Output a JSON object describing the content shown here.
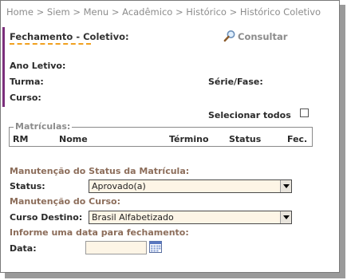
{
  "breadcrumb": "Home > Siem > Menu > Acadêmico > Histórico > Histórico Coletivo",
  "title": "Fechamento - Coletivo:",
  "consultar": "Consultar",
  "labels": {
    "ano_letivo": "Ano Letivo:",
    "turma": "Turma:",
    "serie_fase": "Série/Fase:",
    "curso": "Curso:",
    "selecionar_todos": "Selecionar todos"
  },
  "matriculas": {
    "legend": "Matrículas:",
    "columns": [
      "RM",
      "Nome",
      "Término",
      "Status",
      "Fec."
    ]
  },
  "status_section": {
    "heading": "Manutenção do Status da Matrícula:",
    "label": "Status:",
    "value": "Aprovado(a)"
  },
  "curso_section": {
    "heading": "Manutenção do Curso:",
    "label": "Curso Destino:",
    "value": "Brasil Alfabetizado"
  },
  "data_section": {
    "heading": "Informe uma data para fechamento:",
    "label": "Data:",
    "value": ""
  },
  "colors": {
    "accent_bar": "#7b2f7b",
    "underline": "#f0a020",
    "section_heading": "#8c6d5a"
  },
  "icons": {
    "search": "magnifier-icon",
    "calendar": "calendar-icon"
  }
}
